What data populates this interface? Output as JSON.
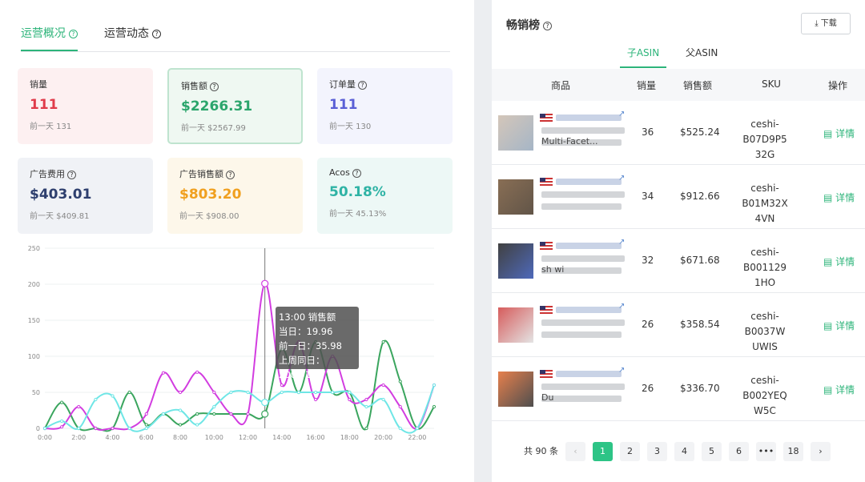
{
  "tabs": [
    {
      "label": "运营概况",
      "active": true
    },
    {
      "label": "运营动态",
      "active": false
    }
  ],
  "cards": [
    {
      "label": "销量",
      "value": "111",
      "prev": "前一天 131",
      "color": "#e03b4a",
      "bg": "#fdf0f1",
      "help": false
    },
    {
      "label": "销售额",
      "value": "$2266.31",
      "prev": "前一天 $2567.99",
      "color": "#2ba56c",
      "bg": "#eff8f2",
      "help": true
    },
    {
      "label": "订单量",
      "value": "111",
      "prev": "前一天 130",
      "color": "#5a5fd6",
      "bg": "#f3f4fd",
      "help": true
    },
    {
      "label": "广告费用",
      "value": "$403.01",
      "prev": "前一天 $409.81",
      "color": "#2e3f6e",
      "bg": "#f0f2f6",
      "help": true
    },
    {
      "label": "广告销售额",
      "value": "$803.20",
      "prev": "前一天 $908.00",
      "color": "#f0a020",
      "bg": "#fdf7ea",
      "help": true
    },
    {
      "label": "Acos",
      "value": "50.18%",
      "prev": "前一天 45.13%",
      "color": "#2fb3a5",
      "bg": "#edf8f6",
      "help": true
    }
  ],
  "chart_data": {
    "type": "line",
    "x": [
      "0:00",
      "1:00",
      "2:00",
      "3:00",
      "4:00",
      "5:00",
      "6:00",
      "7:00",
      "8:00",
      "9:00",
      "10:00",
      "11:00",
      "12:00",
      "13:00",
      "14:00",
      "15:00",
      "16:00",
      "17:00",
      "18:00",
      "19:00",
      "20:00",
      "21:00",
      "22:00",
      "23:00"
    ],
    "xticks": [
      "0:00",
      "2:00",
      "4:00",
      "6:00",
      "8:00",
      "10:00",
      "12:00",
      "14:00",
      "16:00",
      "18:00",
      "20:00",
      "22:00"
    ],
    "yticks": [
      "0",
      "50",
      "100",
      "150",
      "200",
      "250"
    ],
    "ylim": [
      0,
      250
    ],
    "series": [
      {
        "color": "#3aa55e",
        "values": [
          0,
          36,
          0,
          0,
          0,
          50,
          5,
          20,
          5,
          20,
          20,
          20,
          20,
          19.96,
          110,
          50,
          120,
          50,
          50,
          0,
          120,
          65,
          0,
          30
        ]
      },
      {
        "color": "#d23de0",
        "values": [
          0,
          2,
          30,
          0,
          0,
          0,
          20,
          77,
          50,
          78,
          50,
          20,
          20,
          200.91,
          60,
          120,
          40,
          100,
          40,
          40,
          60,
          30,
          0,
          60
        ]
      },
      {
        "color": "#6fe6e6",
        "values": [
          0,
          10,
          0,
          40,
          45,
          0,
          0,
          20,
          25,
          5,
          30,
          50,
          50,
          35.98,
          50,
          50,
          50,
          50,
          50,
          30,
          40,
          0,
          0,
          60
        ]
      }
    ],
    "tooltip": {
      "title": "13:00 销售额",
      "lines": [
        "当日：19.96",
        "前一日：35.98",
        "上周同日：200.91"
      ]
    }
  },
  "right": {
    "title": "畅销榜",
    "download": "下载",
    "subtabs": [
      "子ASIN",
      "父ASIN"
    ],
    "columns": [
      "商品",
      "销量",
      "销售额",
      "SKU",
      "操作"
    ],
    "rows": [
      {
        "qty": "36",
        "sales": "$525.24",
        "sku1": "ceshi-B07D9P5",
        "sku2": "32G",
        "action": "详情",
        "name_line": "Multi-Facet..."
      },
      {
        "qty": "34",
        "sales": "$912.66",
        "sku1": "ceshi-B01M32X",
        "sku2": "4VN",
        "action": "详情",
        "name_line": ""
      },
      {
        "qty": "32",
        "sales": "$671.68",
        "sku1": "ceshi-B001129",
        "sku2": "1HO",
        "action": "详情",
        "name_line": "sh wi"
      },
      {
        "qty": "26",
        "sales": "$358.54",
        "sku1": "ceshi-B0037W",
        "sku2": "UWIS",
        "action": "详情",
        "name_line": ""
      },
      {
        "qty": "26",
        "sales": "$336.70",
        "sku1": "ceshi-B002YEQ",
        "sku2": "W5C",
        "action": "详情",
        "name_line": "Du"
      }
    ],
    "pagination": {
      "total": "共 90 条",
      "pages": [
        "1",
        "2",
        "3",
        "4",
        "5",
        "6",
        "•••",
        "18"
      ],
      "current": "1"
    }
  }
}
